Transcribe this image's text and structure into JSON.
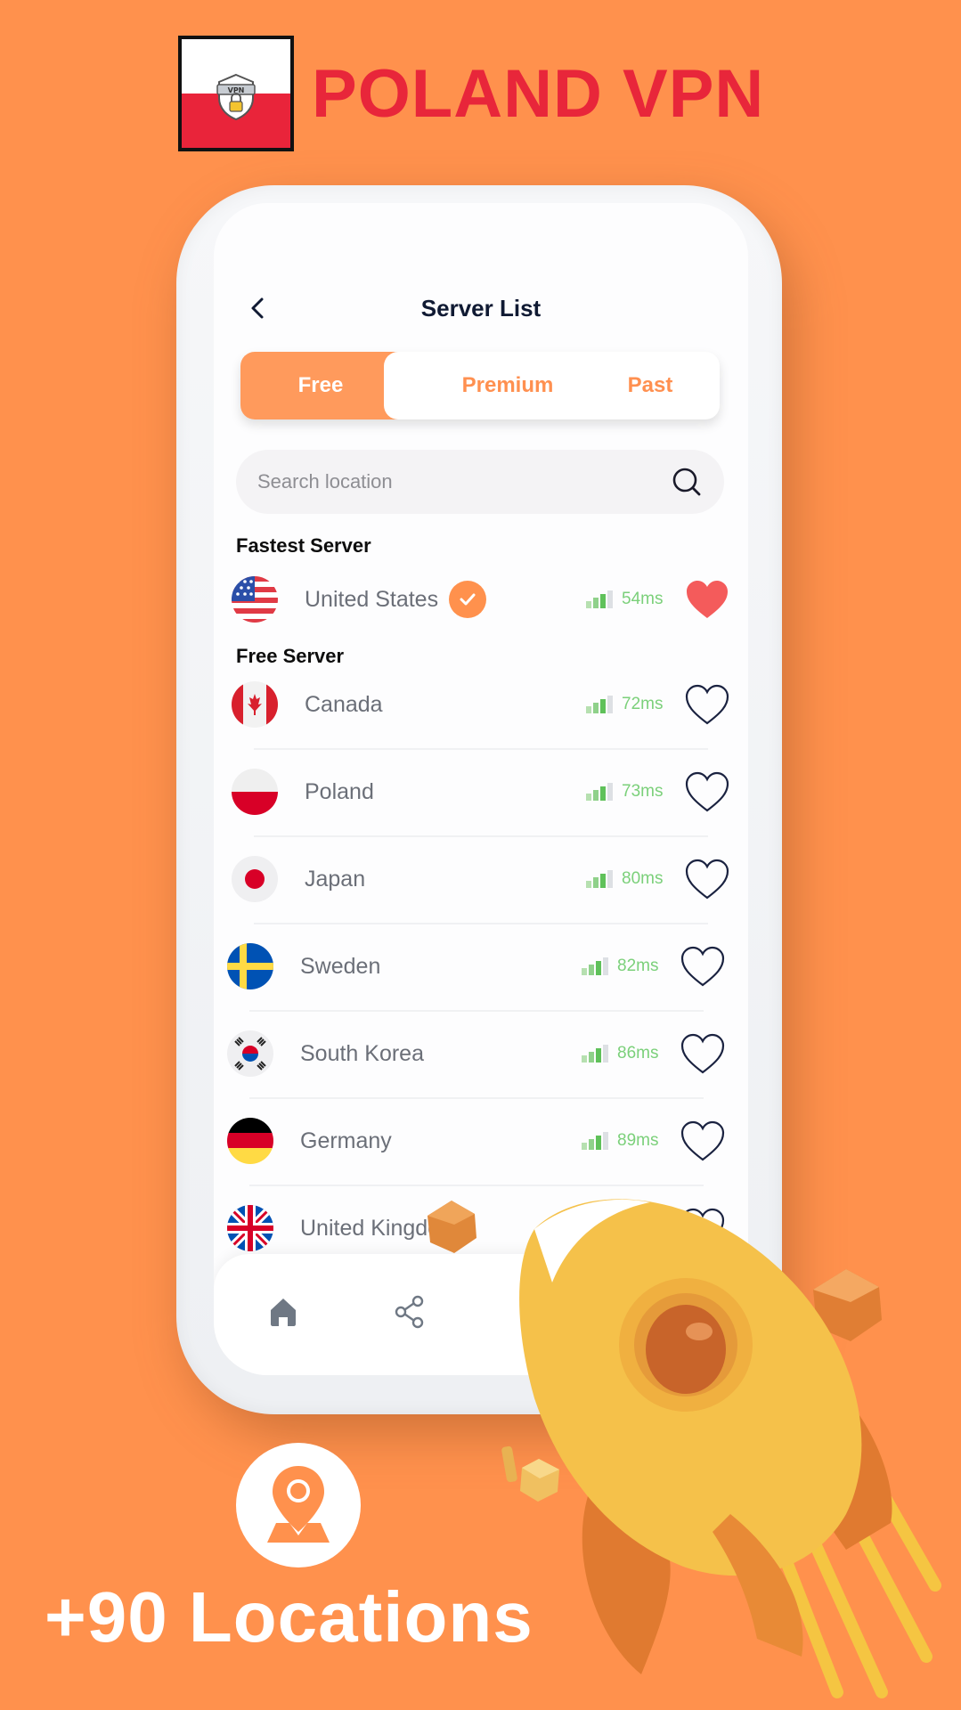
{
  "brand": {
    "title": "POLAND VPN",
    "badge_text": "VPN",
    "colors": {
      "red": "#e8263a",
      "background": "#ff914d"
    }
  },
  "header": {
    "title": "Server List",
    "back_icon": "chevron-left-icon"
  },
  "tabs": [
    {
      "label": "Free",
      "active": true
    },
    {
      "label": "Premium",
      "active": false
    },
    {
      "label": "Past",
      "active": false
    }
  ],
  "search": {
    "placeholder": "Search location",
    "value": "",
    "icon": "search-icon"
  },
  "sections": {
    "fastest": "Fastest Server",
    "free": "Free Server"
  },
  "fastest_server": {
    "country": "United States",
    "ping": "54ms",
    "selected": true,
    "favorite": true,
    "signal_bars": 3
  },
  "free_servers": [
    {
      "country": "Canada",
      "ping": "72ms",
      "favorite": false,
      "signal_bars": 3
    },
    {
      "country": "Poland",
      "ping": "73ms",
      "favorite": false,
      "signal_bars": 3
    },
    {
      "country": "Japan",
      "ping": "80ms",
      "favorite": false,
      "signal_bars": 3
    },
    {
      "country": "Sweden",
      "ping": "82ms",
      "favorite": false,
      "signal_bars": 3
    },
    {
      "country": "South Korea",
      "ping": "86ms",
      "favorite": false,
      "signal_bars": 3
    },
    {
      "country": "Germany",
      "ping": "89ms",
      "favorite": false,
      "signal_bars": 3
    },
    {
      "country": "United Kingdom",
      "ping": "",
      "favorite": false,
      "signal_bars": 3
    }
  ],
  "bottom_nav": {
    "items": [
      "home-icon",
      "share-icon"
    ]
  },
  "promo": {
    "headline": "+90 Locations",
    "icon": "map-pin-icon"
  },
  "colors": {
    "accent": "#ff914d",
    "tab_active": "#ff9a5c",
    "ping_green": "#7bd07a",
    "favorite_red": "#f45b5b",
    "heart_outline": "#1a2240"
  }
}
